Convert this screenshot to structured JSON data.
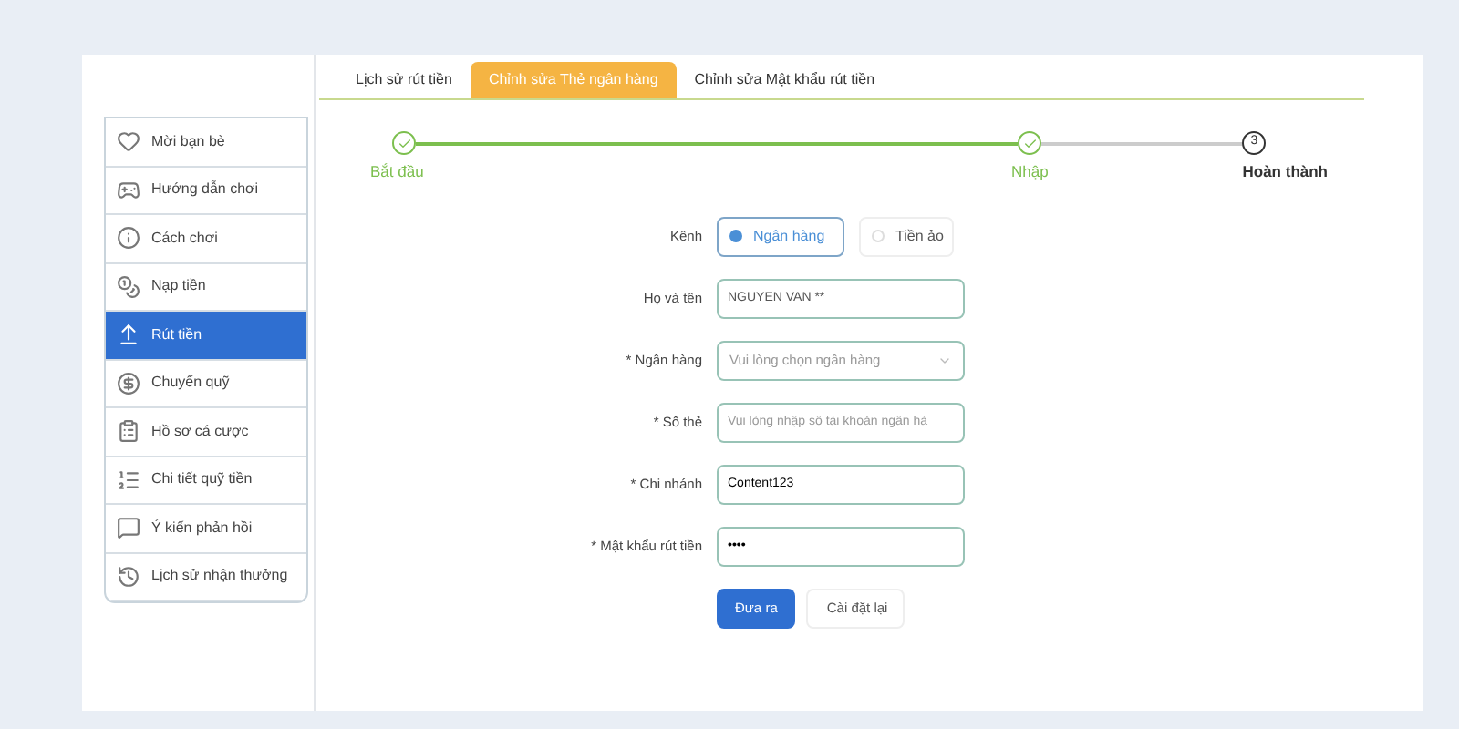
{
  "sidebar": {
    "items": [
      {
        "label": "Mời bạn bè",
        "selected": false
      },
      {
        "label": "Hướng dẫn chơi",
        "selected": false
      },
      {
        "label": "Cách chơi",
        "selected": false
      },
      {
        "label": "Nạp tiền",
        "selected": false
      },
      {
        "label": "Rút tiền",
        "selected": true
      },
      {
        "label": "Chuyển quỹ",
        "selected": false
      },
      {
        "label": "Hồ sơ cá cược",
        "selected": false
      },
      {
        "label": "Chi tiết quỹ tiền",
        "selected": false
      },
      {
        "label": "Ý kiến phản hồi",
        "selected": false
      },
      {
        "label": "Lịch sử nhận thưởng",
        "selected": false
      }
    ]
  },
  "tabs": [
    {
      "label": "Lịch sử rút tiền",
      "selected": false
    },
    {
      "label": "Chỉnh sửa Thẻ ngân hàng",
      "selected": true
    },
    {
      "label": "Chỉnh sửa Mật khẩu rút tiền",
      "selected": false
    }
  ],
  "steps": [
    {
      "label": "Bắt đầu",
      "done": true
    },
    {
      "label": "Nhập",
      "done": true
    },
    {
      "label": "Hoàn thành",
      "number": "3",
      "done": false
    }
  ],
  "form": {
    "channel": {
      "label": "Kênh",
      "options": [
        {
          "label": "Ngân hàng",
          "selected": true
        },
        {
          "label": "Tiền ảo",
          "selected": false
        }
      ]
    },
    "fields": [
      {
        "kind": "text",
        "label": "Họ và tên",
        "value": "NGUYEN VAN **"
      },
      {
        "kind": "select",
        "label": "* Ngân hàng",
        "placeholder": "Vui lòng chọn ngân hàng"
      },
      {
        "kind": "text",
        "label": "* Số thẻ",
        "placeholder": "Vui lòng nhập số tài khoản ngân hà"
      },
      {
        "kind": "text",
        "label": "* Chi nhánh",
        "value": "Content123"
      },
      {
        "kind": "password",
        "label": "* Mật khẩu rút tiền",
        "value": "••••"
      }
    ],
    "buttons": [
      {
        "label": "Đưa ra",
        "primary": true
      },
      {
        "label": "Cài đặt lại",
        "primary": false
      }
    ]
  }
}
